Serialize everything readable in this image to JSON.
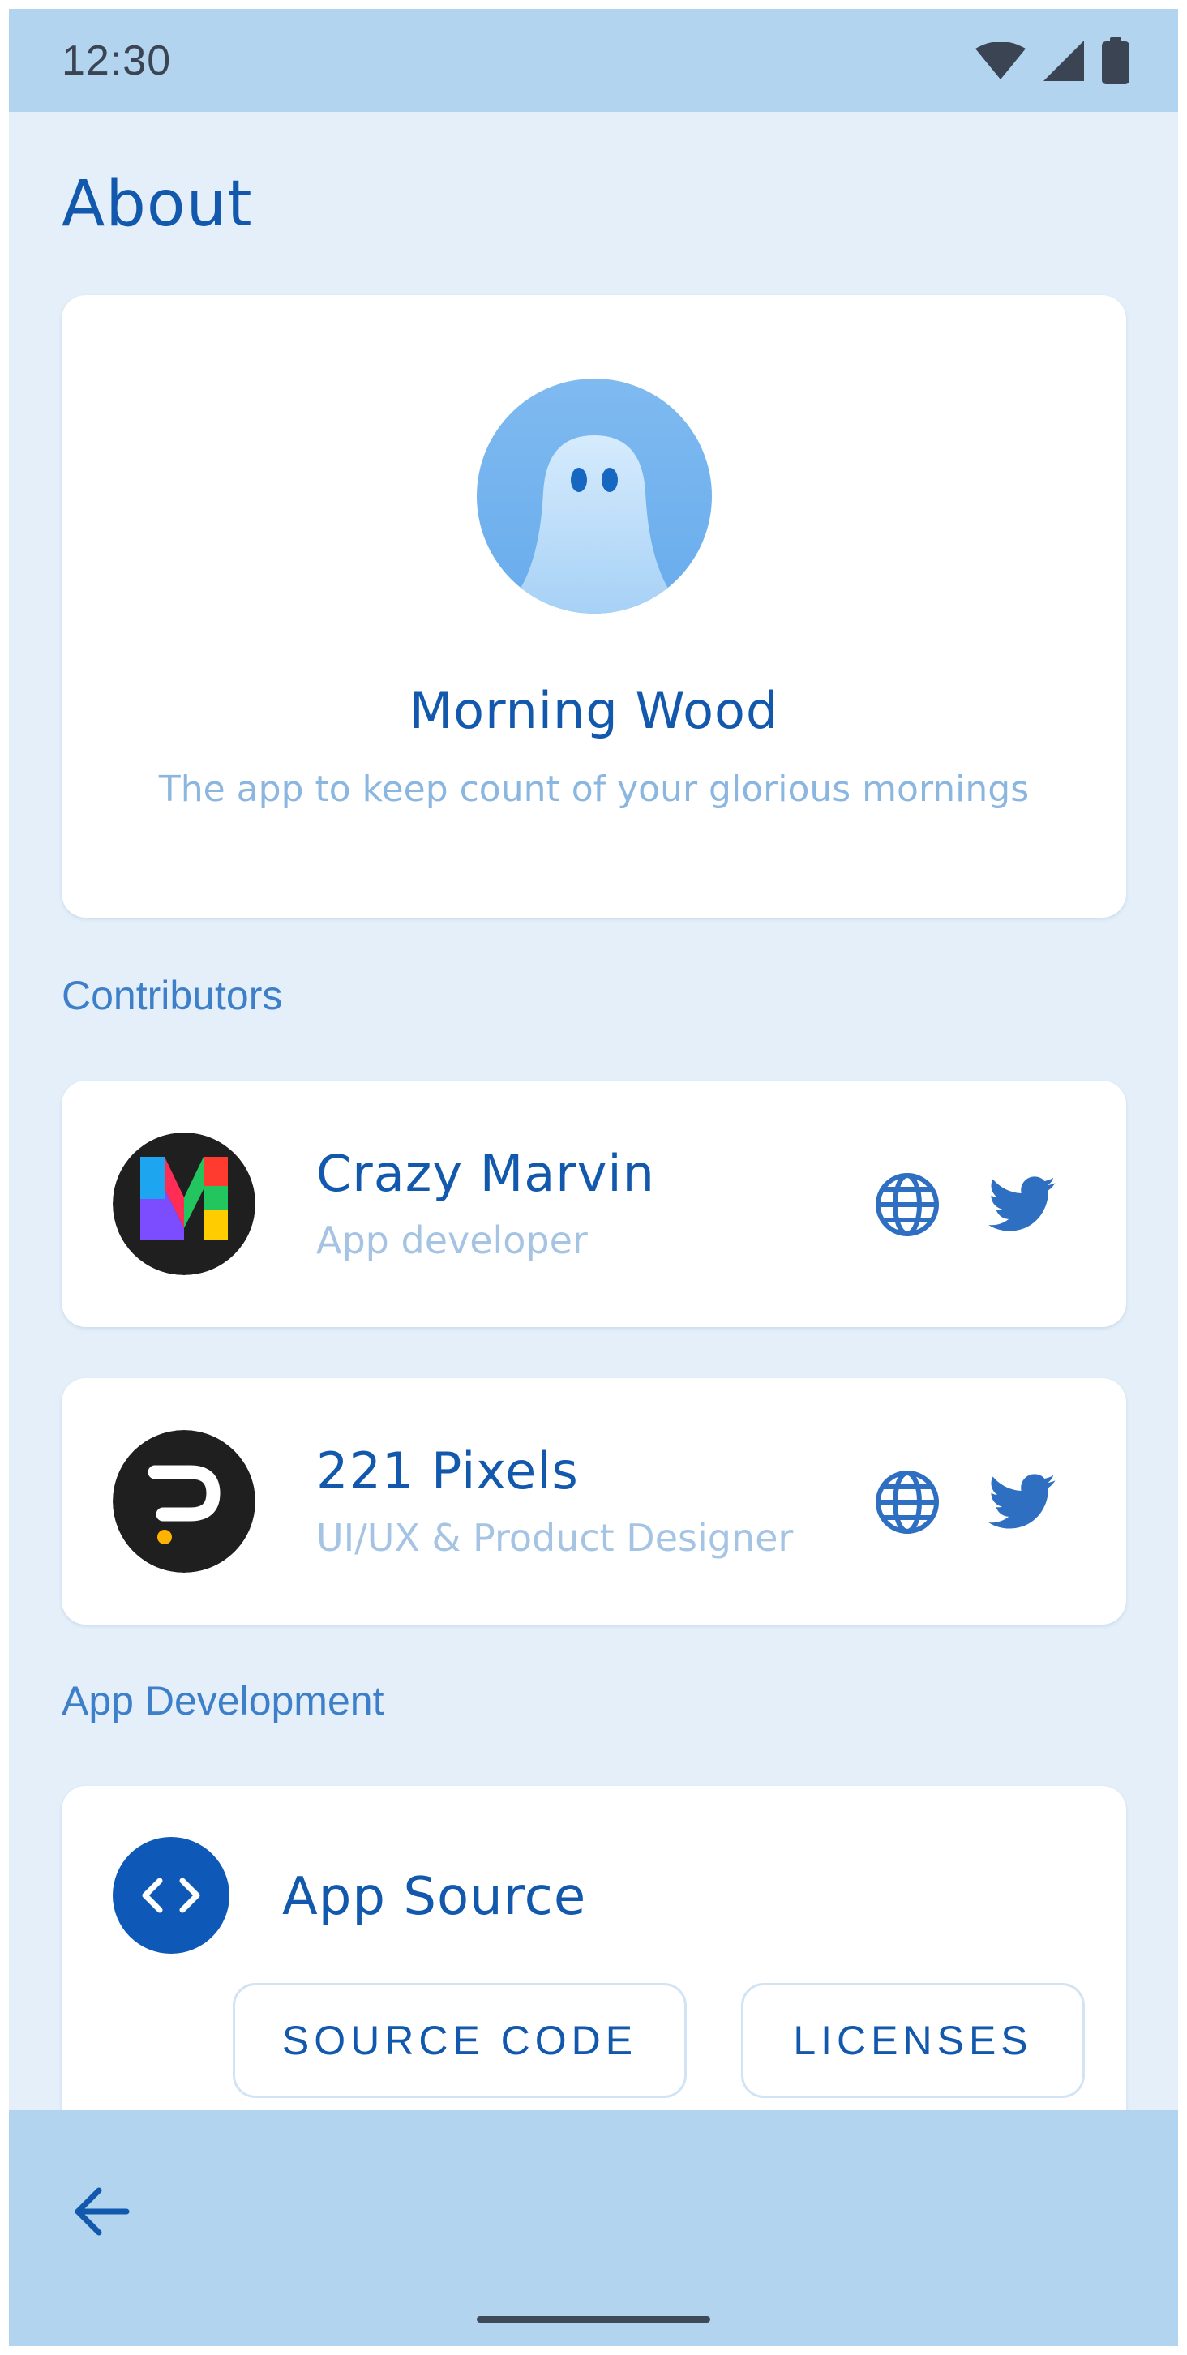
{
  "status_bar": {
    "time": "12:30",
    "icons": [
      "wifi-icon",
      "cellular-signal-icon",
      "battery-icon"
    ]
  },
  "page": {
    "title": "About"
  },
  "app": {
    "name": "Morning Wood",
    "tagline": "The app to keep count of your glorious mornings",
    "logo_icon": "ghost-logo"
  },
  "sections": {
    "contributors": "Contributors",
    "app_development": "App Development"
  },
  "contributors": [
    {
      "name": "Crazy Marvin",
      "role": "App developer",
      "avatar_icon": "multicolor-m-avatar",
      "links": [
        "globe-icon",
        "twitter-icon"
      ]
    },
    {
      "name": "221 Pixels",
      "role": "UI/UX & Product Designer",
      "avatar_icon": "pixels-p-avatar",
      "links": [
        "globe-icon",
        "twitter-icon"
      ]
    }
  ],
  "app_source": {
    "title": "App Source",
    "icon": "code-brackets-icon",
    "buttons": {
      "source_code": "SOURCE CODE",
      "licenses": "LICENSES"
    }
  },
  "navigation": {
    "back_icon": "arrow-back-icon"
  },
  "colors": {
    "primary": "#1259ad",
    "accent": "#3d7fc9",
    "background": "#e4eff9",
    "bar": "#b3d4ef",
    "muted_text": "#8ab6e0"
  }
}
